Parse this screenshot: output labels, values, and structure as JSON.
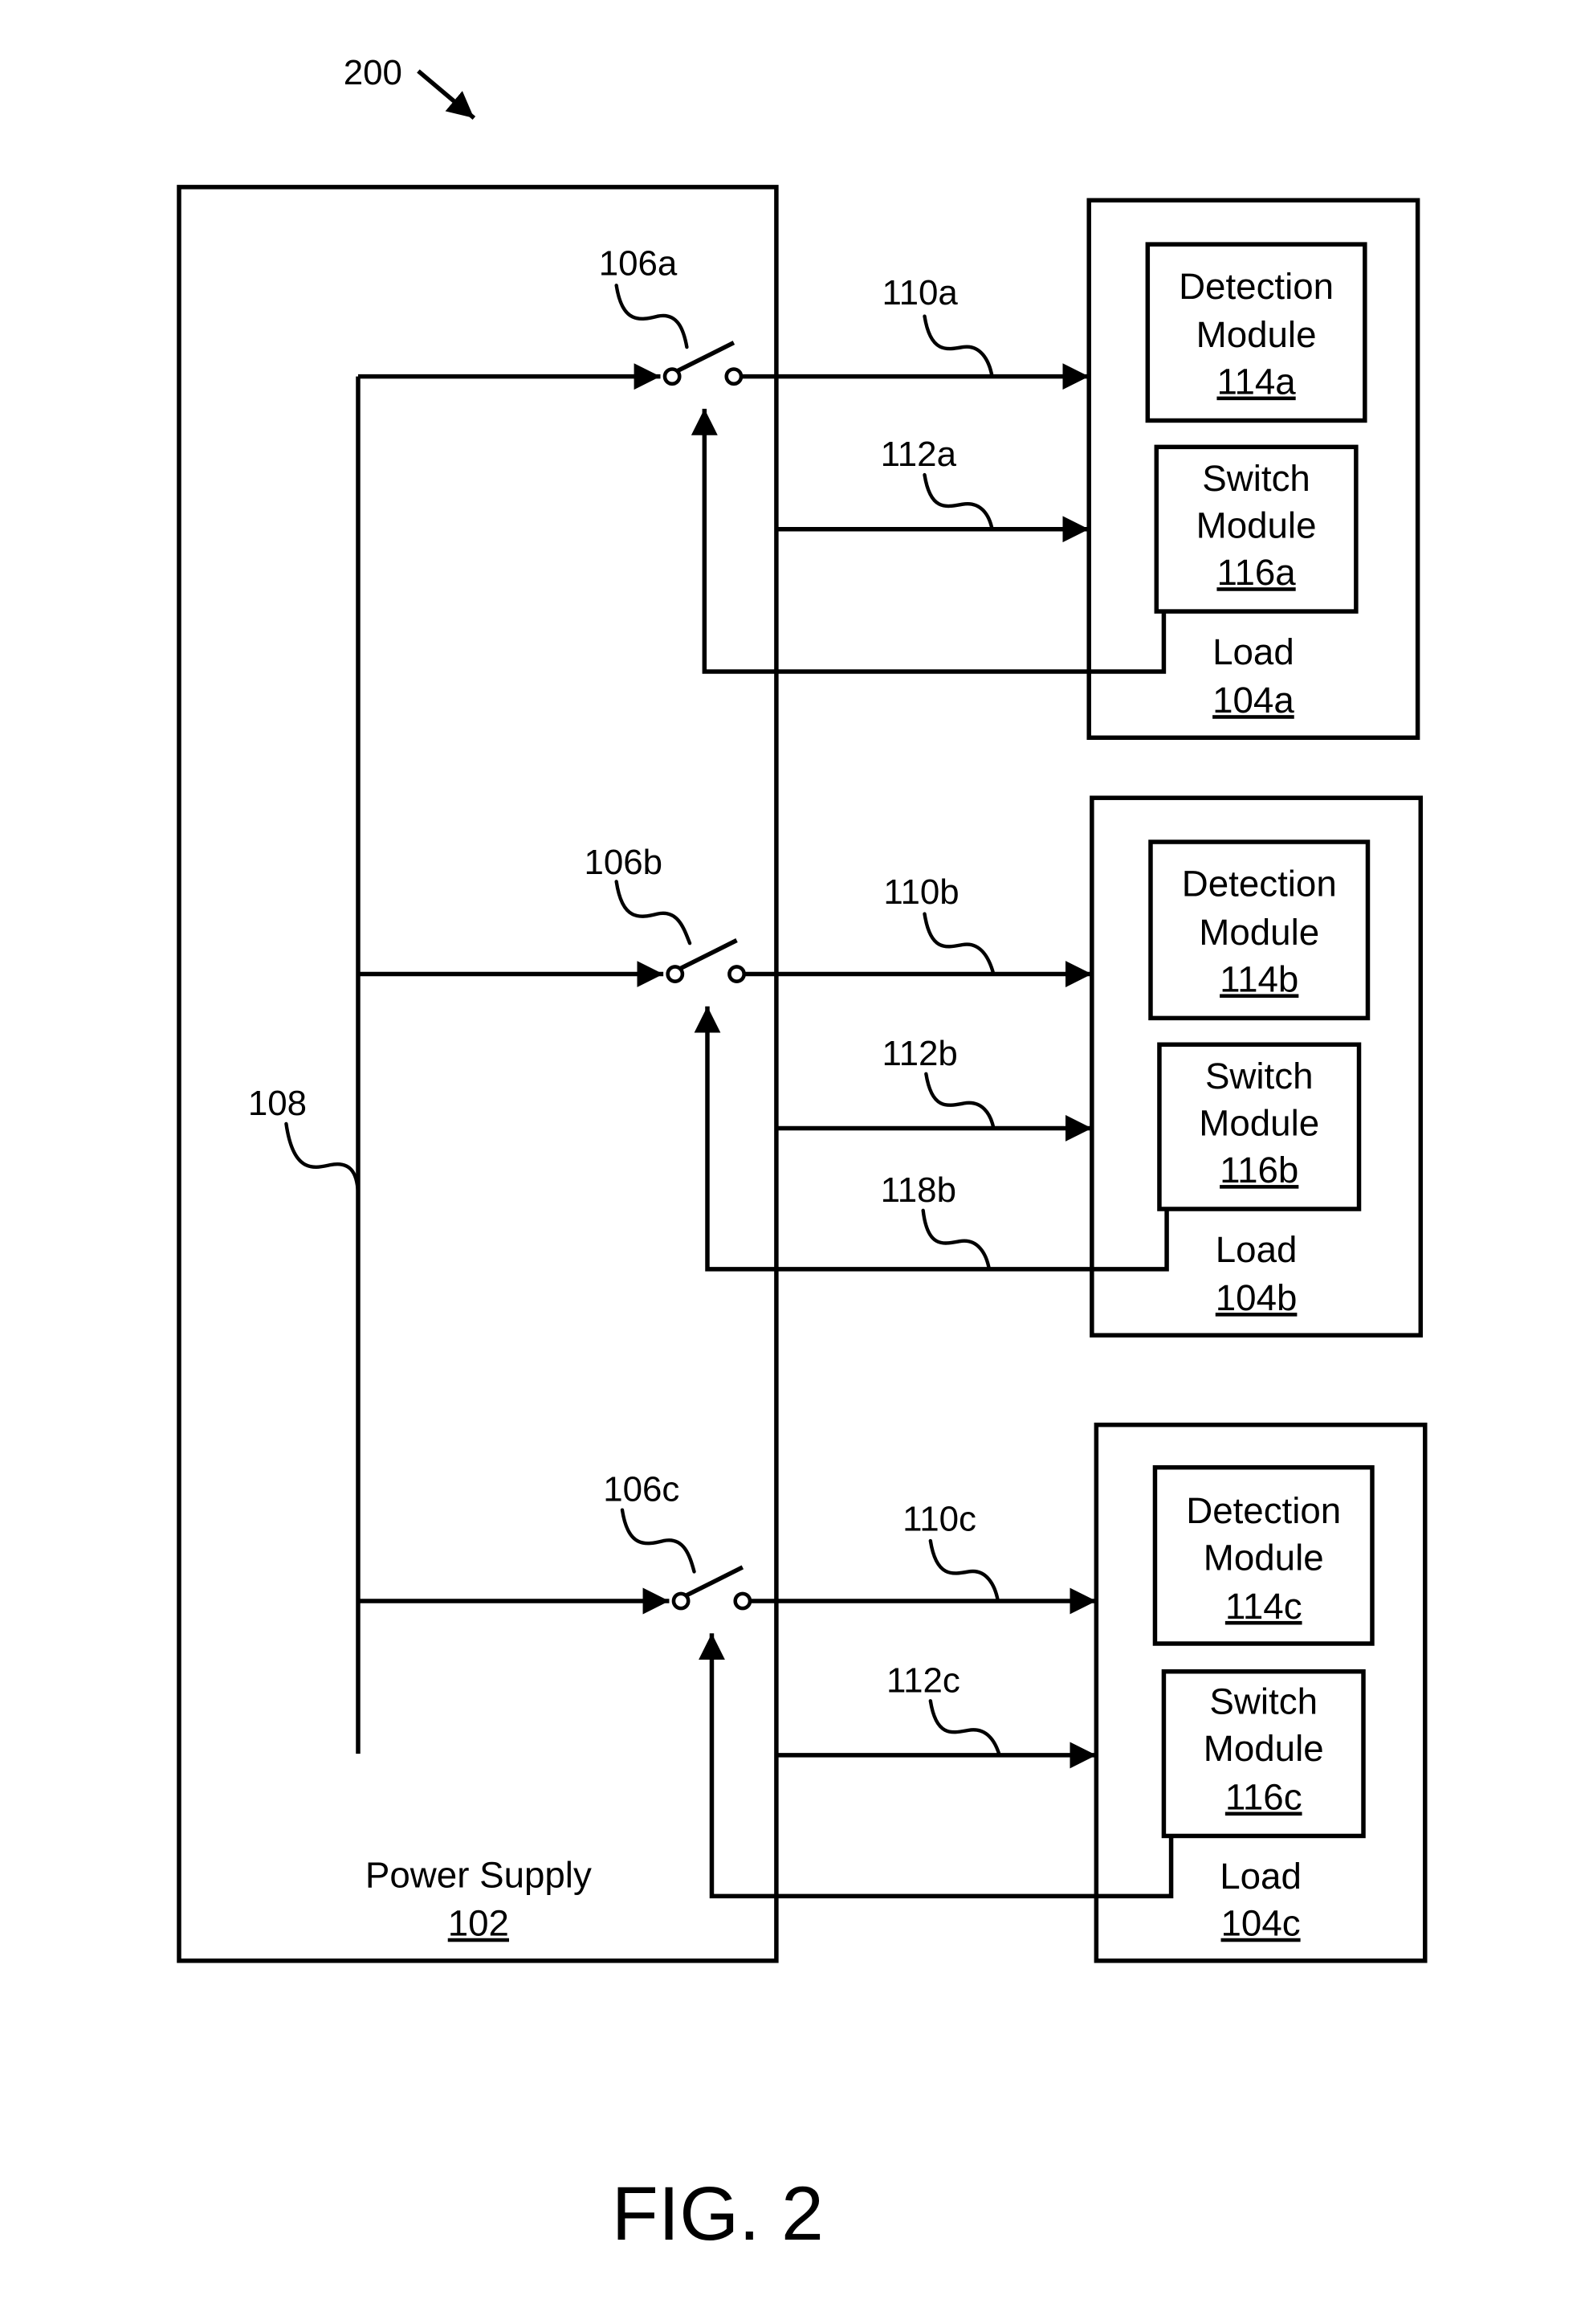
{
  "figure": {
    "ref_number": "200",
    "caption": "FIG. 2"
  },
  "power_supply": {
    "label": "Power Supply",
    "ref": "102",
    "bus_ref": "108"
  },
  "channels": [
    {
      "id": "a",
      "switch_ref": "106a",
      "power_line_ref": "110a",
      "signal_line_ref": "112a",
      "feedback_line_ref": "",
      "load_label": "Load",
      "load_ref": "104a",
      "detection": {
        "line1": "Detection",
        "line2": "Module",
        "ref": "114a"
      },
      "switch_module": {
        "line1": "Switch",
        "line2": "Module",
        "ref": "116a"
      }
    },
    {
      "id": "b",
      "switch_ref": "106b",
      "power_line_ref": "110b",
      "signal_line_ref": "112b",
      "feedback_line_ref": "118b",
      "load_label": "Load",
      "load_ref": "104b",
      "detection": {
        "line1": "Detection",
        "line2": "Module",
        "ref": "114b"
      },
      "switch_module": {
        "line1": "Switch",
        "line2": "Module",
        "ref": "116b"
      }
    },
    {
      "id": "c",
      "switch_ref": "106c",
      "power_line_ref": "110c",
      "signal_line_ref": "112c",
      "feedback_line_ref": "",
      "load_label": "Load",
      "load_ref": "104c",
      "detection": {
        "line1": "Detection",
        "line2": "Module",
        "ref": "114c"
      },
      "switch_module": {
        "line1": "Switch",
        "line2": "Module",
        "ref": "116c"
      }
    }
  ]
}
